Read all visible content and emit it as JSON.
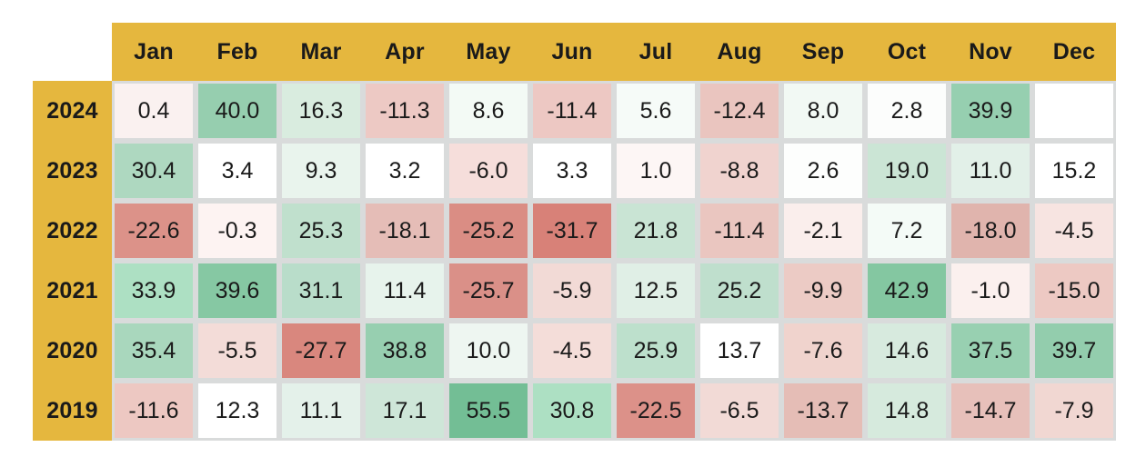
{
  "chart_data": {
    "type": "heatmap",
    "title": "",
    "xlabel": "",
    "ylabel": "",
    "categories": [
      "Jan",
      "Feb",
      "Mar",
      "Apr",
      "May",
      "Jun",
      "Jul",
      "Aug",
      "Sep",
      "Oct",
      "Nov",
      "Dec"
    ],
    "rows": [
      "2024",
      "2023",
      "2022",
      "2021",
      "2020",
      "2019"
    ],
    "colormap": "RdYlGn-diverging",
    "center": 0,
    "vmin": -31.7,
    "vmax": 55.5,
    "values": [
      [
        0.4,
        40.0,
        16.3,
        -11.3,
        8.6,
        -11.4,
        5.6,
        -12.4,
        8.0,
        2.8,
        39.9,
        null
      ],
      [
        30.4,
        3.4,
        9.3,
        3.2,
        -6.0,
        3.3,
        1.0,
        -8.8,
        2.6,
        19.0,
        11.0,
        15.2
      ],
      [
        -22.6,
        -0.3,
        25.3,
        -18.1,
        -25.2,
        -31.7,
        21.8,
        -11.4,
        -2.1,
        7.2,
        -18.0,
        -4.5
      ],
      [
        33.9,
        39.6,
        31.1,
        11.4,
        -25.7,
        -5.9,
        12.5,
        25.2,
        -9.9,
        42.9,
        -1.0,
        -15.0
      ],
      [
        35.4,
        -5.5,
        -27.7,
        38.8,
        10.0,
        -4.5,
        25.9,
        13.7,
        -7.6,
        14.6,
        37.5,
        39.7
      ],
      [
        -11.6,
        12.3,
        11.1,
        17.1,
        55.5,
        30.8,
        -22.5,
        -6.5,
        -13.7,
        14.8,
        -14.7,
        -7.9
      ]
    ],
    "cell_labels": [
      [
        "0.4",
        "40.0",
        "16.3",
        "-11.3",
        "8.6",
        "-11.4",
        "5.6",
        "-12.4",
        "8.0",
        "2.8",
        "39.9",
        ""
      ],
      [
        "30.4",
        "3.4",
        "9.3",
        "3.2",
        "-6.0",
        "3.3",
        "1.0",
        "-8.8",
        "2.6",
        "19.0",
        "11.0",
        "15.2"
      ],
      [
        "-22.6",
        "-0.3",
        "25.3",
        "-18.1",
        "-25.2",
        "-31.7",
        "21.8",
        "-11.4",
        "-2.1",
        "7.2",
        "-18.0",
        "-4.5"
      ],
      [
        "33.9",
        "39.6",
        "31.1",
        "11.4",
        "-25.7",
        "-5.9",
        "12.5",
        "25.2",
        "-9.9",
        "42.9",
        "-1.0",
        "-15.0"
      ],
      [
        "35.4",
        "-5.5",
        "-27.7",
        "38.8",
        "10.0",
        "-4.5",
        "25.9",
        "13.7",
        "-7.6",
        "14.6",
        "37.5",
        "39.7"
      ],
      [
        "-11.6",
        "12.3",
        "11.1",
        "17.1",
        "55.5",
        "30.8",
        "-22.5",
        "-6.5",
        "-13.7",
        "14.8",
        "-14.7",
        "-7.9"
      ]
    ],
    "cell_colors": [
      [
        "#faf1f0",
        "#96ceaf",
        "#d9ecdf",
        "#edc9c4",
        "#f3faf5",
        "#edc8c3",
        "#f6fbf8",
        "#eac5bf",
        "#f2f9f4",
        "#fcfdfc",
        "#96cfb0",
        "#ffffff"
      ],
      [
        "#aed8c0",
        "#ffffff",
        "#e9f4ed",
        "#ffffff",
        "#f6dedb",
        "#ffffff",
        "#fdf6f5",
        "#f0d3cf",
        "#fdfefd",
        "#cbe5d5",
        "#e2f0e8",
        "#dbedе2"
      ],
      [
        "#dc9289",
        "#fdf3f2",
        "#c0e0cd",
        "#e5bdb7",
        "#da8d84",
        "#d88178",
        "#c9e4d4",
        "#eac6c0",
        "#faeeec",
        "#f4fbf7",
        "#e0b4ad",
        "#f7e4e1"
      ],
      [
        "#ade0c3",
        "#86c8a3",
        "#b9ddca",
        "#e7f3ec",
        "#da9088",
        "#f2dad6",
        "#e0efe6",
        "#bfdfcd",
        "#eccbc5",
        "#84c7a1",
        "#fbf0ee",
        "#edc9c3"
      ],
      [
        "#a9d7bd",
        "#f3dcd8",
        "#d9877e",
        "#97cfb0",
        "#eef6f1",
        "#f4ddd9",
        "#bde0cc",
        "#dcedе3",
        "#f0d3cd",
        "#d7eade",
        "#98d0b1",
        "#93cdad"
      ],
      [
        "#edc8c2",
        "#dfefе5",
        "#e4f1ea",
        "#cee6d8",
        "#73be95",
        "#ade0c3",
        "#dc9189",
        "#f2dad6",
        "#e5bdb6",
        "#d6eadd",
        "#e7c0ba",
        "#f1d7d2"
      ]
    ]
  },
  "header": {
    "corner_label": ""
  }
}
